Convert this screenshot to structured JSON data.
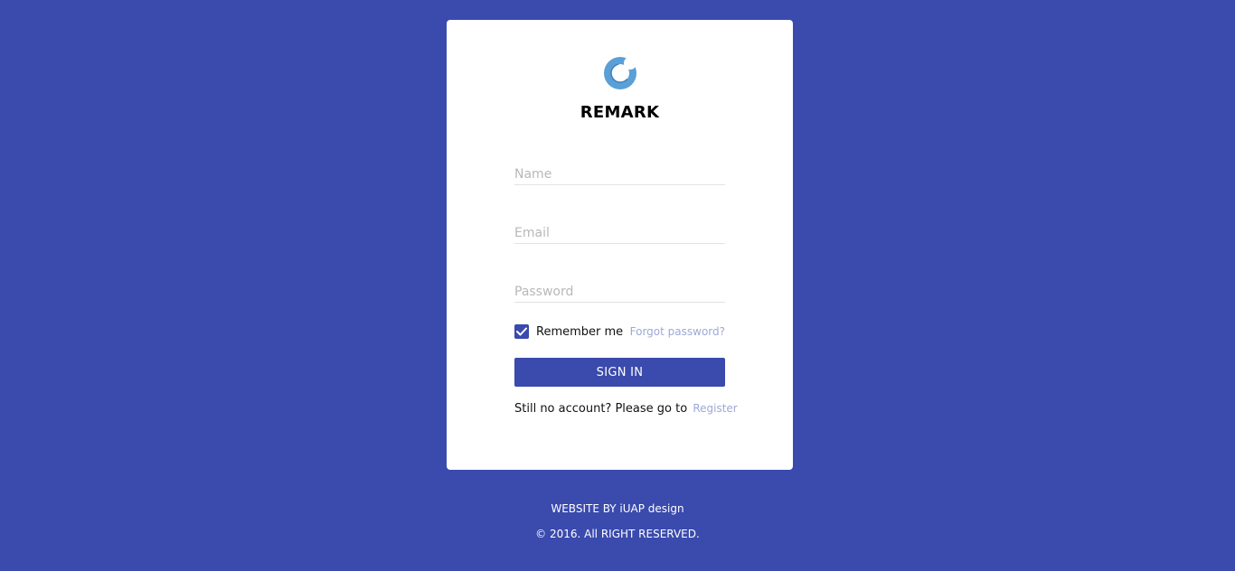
{
  "brand": {
    "name": "REMARK",
    "logo_icon": "crescent-logo-icon",
    "logo_color": "#5a9fd6"
  },
  "form": {
    "name_placeholder": "Name",
    "email_placeholder": "Email",
    "password_placeholder": "Password",
    "name_value": "",
    "email_value": "",
    "password_value": "",
    "remember_label": "Remember me",
    "remember_checked": true,
    "forgot_label": "Forgot password?",
    "signin_label": "SIGN IN",
    "no_account_text": "Still no account? Please go to",
    "register_label": "Register"
  },
  "footer": {
    "credit": "WEBSITE BY iUAP design",
    "copyright": "© 2016. All RIGHT RESERVED."
  },
  "colors": {
    "background": "#3a4aad",
    "accent": "#3a4aad",
    "link": "#9fa8d6",
    "card": "#ffffff"
  }
}
